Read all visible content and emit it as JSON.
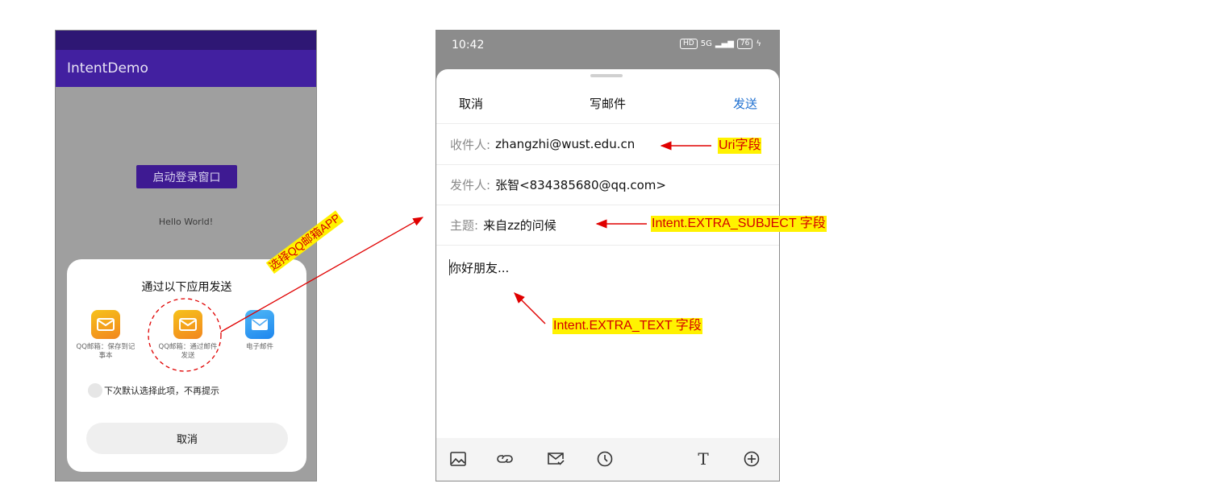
{
  "left_phone": {
    "app_title": "IntentDemo",
    "login_button": "启动登录窗口",
    "hello_text": "Hello World!",
    "share_sheet": {
      "title": "通过以下应用发送",
      "apps": [
        {
          "label": "QQ邮箱：保存到记事本",
          "icon": "qq-mail-icon"
        },
        {
          "label": "QQ邮箱：通过邮件发送",
          "icon": "qq-mail-icon"
        },
        {
          "label": "电子邮件",
          "icon": "email-icon"
        }
      ],
      "default_option": "下次默认选择此项，不再提示",
      "cancel": "取消"
    }
  },
  "right_phone": {
    "status_bar": {
      "time": "10:42",
      "network": "5G",
      "battery": "76"
    },
    "header": {
      "cancel": "取消",
      "title": "写邮件",
      "send": "发送"
    },
    "to": {
      "label": "收件人:",
      "value": "zhangzhi@wust.edu.cn"
    },
    "from": {
      "label": "发件人:",
      "value": "张智<834385680@qq.com>"
    },
    "subject": {
      "label": "主题:",
      "value": "来自zz的问候"
    },
    "body": "你好朋友...",
    "toolbar_icons": [
      "image-icon",
      "link-icon",
      "mail-check-icon",
      "clock-icon",
      "text-format-icon",
      "add-circle-icon"
    ]
  },
  "annotations": {
    "choose_app": "选择QQ邮箱APP",
    "uri": "Uri字段",
    "subject": "Intent.EXTRA_SUBJECT 字段",
    "text": "Intent.EXTRA_TEXT 字段"
  },
  "colors": {
    "annotation_bg": "#fff200",
    "annotation_text": "#d40000",
    "app_bar": "#4220a0",
    "send_blue": "#1e6fd0"
  }
}
